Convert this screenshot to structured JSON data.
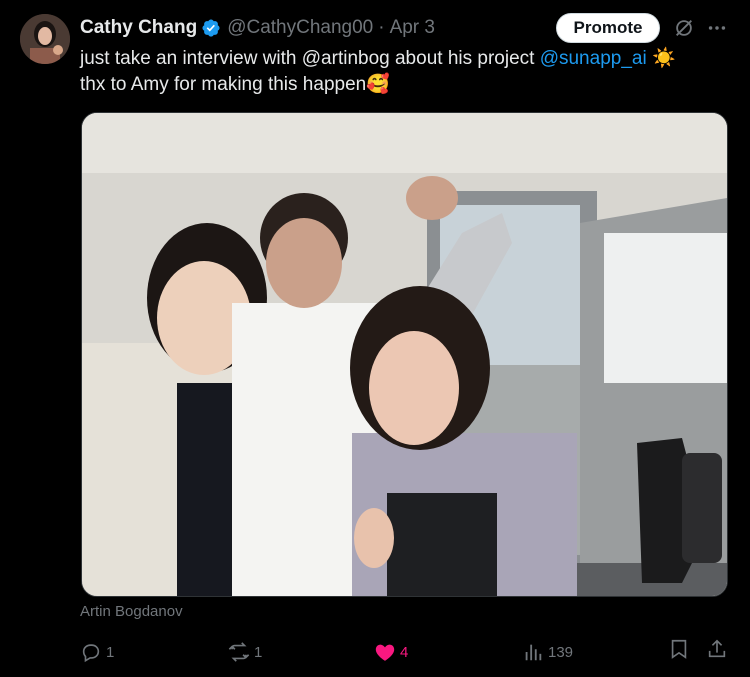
{
  "author": {
    "name": "Cathy Chang",
    "handle": "@CathyChang00",
    "separator": "·",
    "date": "Apr 3",
    "verified": true
  },
  "header": {
    "promote_label": "Promote"
  },
  "post": {
    "line1_pre": "just take an interview with @artinbog about his project ",
    "line1_mention": "@sunapp_ai",
    "line1_emoji": "☀️",
    "line2": "thx to Amy for making this happen",
    "line2_emoji": "🥰"
  },
  "media": {
    "tagged_person": "Artin Bogdanov"
  },
  "actions": {
    "replies": "1",
    "reposts": "1",
    "likes": "4",
    "views": "139"
  },
  "colors": {
    "background": "#000000",
    "text": "#e7e9ea",
    "muted": "#71767b",
    "link": "#1d9bf0",
    "like": "#f91880",
    "verified": "#1d9bf0"
  }
}
